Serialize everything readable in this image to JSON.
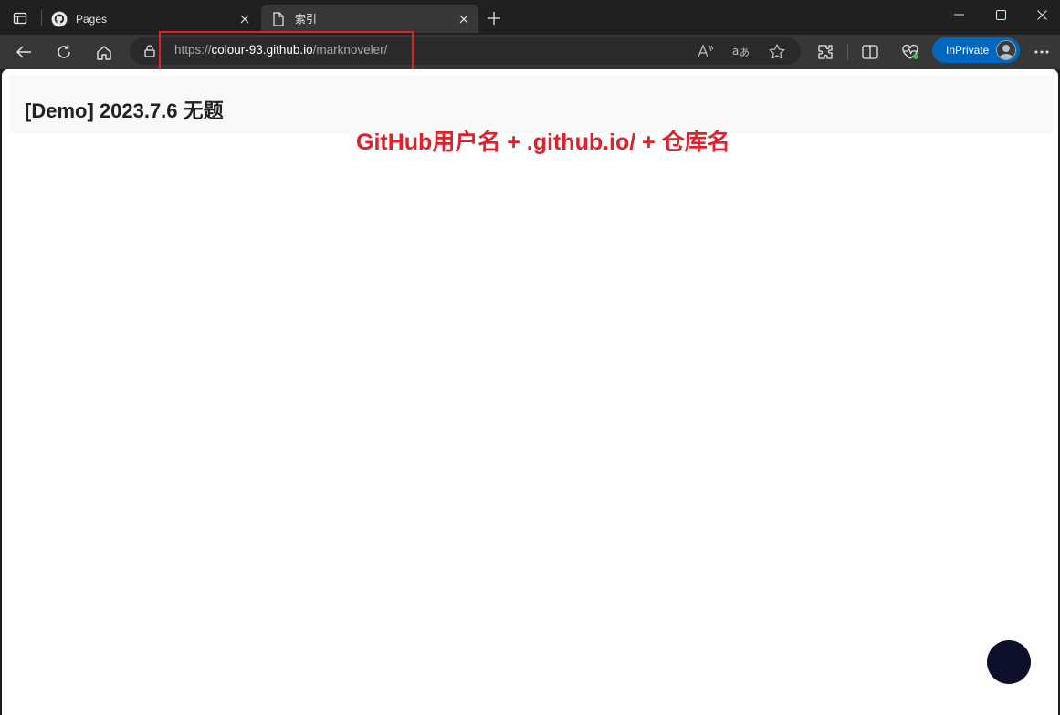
{
  "tabs": [
    {
      "title": "Pages",
      "active": false
    },
    {
      "title": "索引",
      "active": true
    }
  ],
  "address": {
    "scheme": "https://",
    "host": "colour-93.github.io",
    "path": "/marknoveler/"
  },
  "toolbar": {
    "inprivate_label": "InPrivate"
  },
  "page": {
    "title": "[Demo] 2023.7.6 无题"
  },
  "annotation": {
    "text": "GitHub用户名 + .github.io/ + 仓库名",
    "color": "#e0202a"
  },
  "colors": {
    "tabbar": "#202020",
    "toolbar": "#373737",
    "inprivate": "#0067c0",
    "highlight_box": "#e02024",
    "fab": "#0d0f2b"
  }
}
